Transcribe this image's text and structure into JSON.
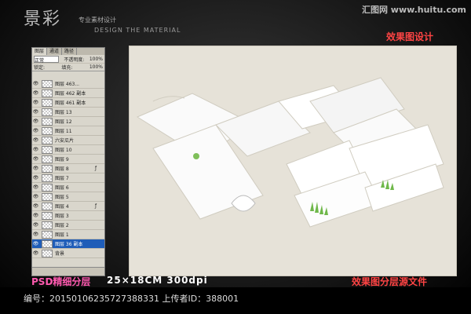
{
  "watermark": {
    "brand": "景彩",
    "brand_sub": "专业素材设计",
    "brand_sub2": "DESIGN THE MATERIAL",
    "site": "汇图网 www.huitu.com"
  },
  "title": "效果图设计",
  "layers_panel": {
    "tabs": [
      "图层",
      "通道",
      "路径"
    ],
    "blend_mode": "正常",
    "opacity_label": "不透明度:",
    "opacity_value": "100%",
    "lock_label": "锁定:",
    "fill_label": "填充:",
    "fill_value": "100%",
    "layers": [
      {
        "name": "图层 463..."
      },
      {
        "name": "图层 462 副本"
      },
      {
        "name": "图层 461 副本"
      },
      {
        "name": "图层 13"
      },
      {
        "name": "图层 12"
      },
      {
        "name": "图层 11"
      },
      {
        "name": "六安瓜片"
      },
      {
        "name": "图层 10"
      },
      {
        "name": "图层 9"
      },
      {
        "name": "图层 8",
        "fx": true
      },
      {
        "name": "图层 7"
      },
      {
        "name": "图层 6"
      },
      {
        "name": "图层 5"
      },
      {
        "name": "图层 4",
        "fx": true
      },
      {
        "name": "图层 3"
      },
      {
        "name": "图层 2"
      },
      {
        "name": "图层 1"
      },
      {
        "name": "图层 36 副本",
        "active": true
      },
      {
        "name": "背景"
      }
    ]
  },
  "bottom": {
    "psd_label": "PSD精细分层",
    "size_label": "25×18CM  300dpi",
    "layered_label": "效果图分层源文件"
  },
  "footer": {
    "text": "编号：20150106235727388331  上传者ID：388001"
  },
  "colors": {
    "accent_red": "#ff4444",
    "accent_pink": "#ff5ab0",
    "selected_layer": "#1f5db8"
  }
}
